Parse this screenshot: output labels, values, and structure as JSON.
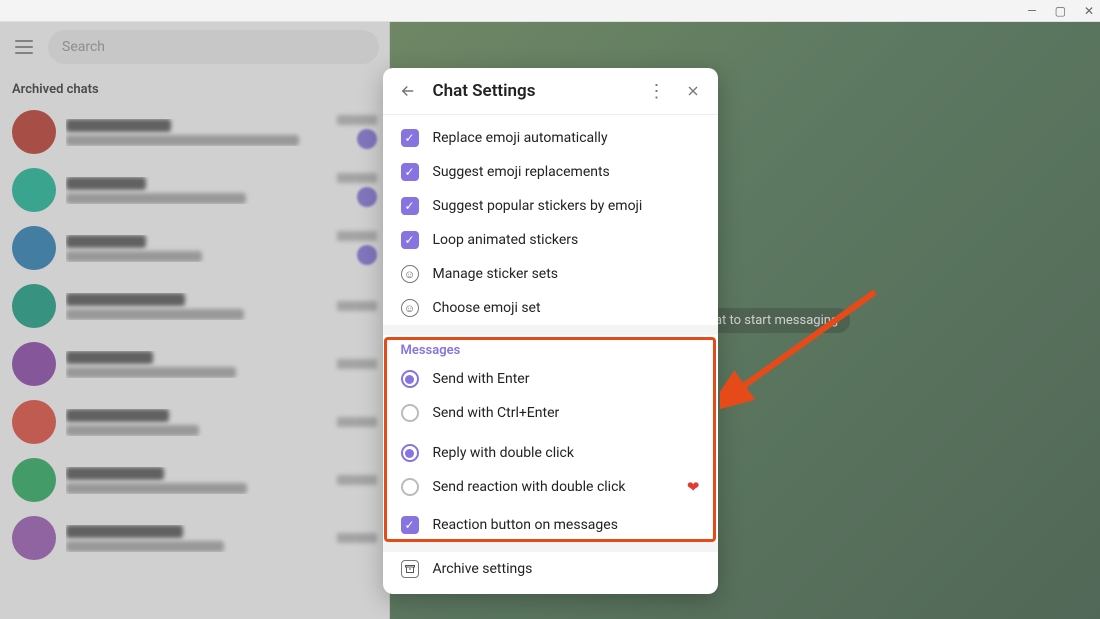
{
  "window": {
    "minimize": "—",
    "maximize": "▢",
    "close": "✕"
  },
  "sidebar": {
    "search_placeholder": "Search",
    "archived_label": "Archived chats",
    "items": [
      {
        "avatar_color": "#c0392b"
      },
      {
        "avatar_color": "#1abc9c"
      },
      {
        "avatar_color": "#2980b9"
      },
      {
        "avatar_color": "#16a085"
      },
      {
        "avatar_color": "#8e44ad"
      },
      {
        "avatar_color": "#e74c3c"
      },
      {
        "avatar_color": "#27ae60"
      },
      {
        "avatar_color": "#9b59b6"
      }
    ]
  },
  "chat_hint": "Select a chat to start messaging",
  "dialog": {
    "title": "Chat Settings",
    "checks": [
      {
        "label": "Replace emoji automatically"
      },
      {
        "label": "Suggest emoji replacements"
      },
      {
        "label": "Suggest popular stickers by emoji"
      },
      {
        "label": "Loop animated stickers"
      }
    ],
    "manage_sticker": "Manage sticker sets",
    "choose_emoji": "Choose emoji set",
    "messages_label": "Messages",
    "radio1": [
      {
        "label": "Send with Enter",
        "selected": true
      },
      {
        "label": "Send with Ctrl+Enter",
        "selected": false
      }
    ],
    "radio2": [
      {
        "label": "Reply with double click",
        "selected": true
      },
      {
        "label": "Send reaction with double click",
        "selected": false,
        "heart": "❤"
      }
    ],
    "reaction_btn_label": "Reaction button on messages",
    "archive_settings": "Archive settings"
  }
}
